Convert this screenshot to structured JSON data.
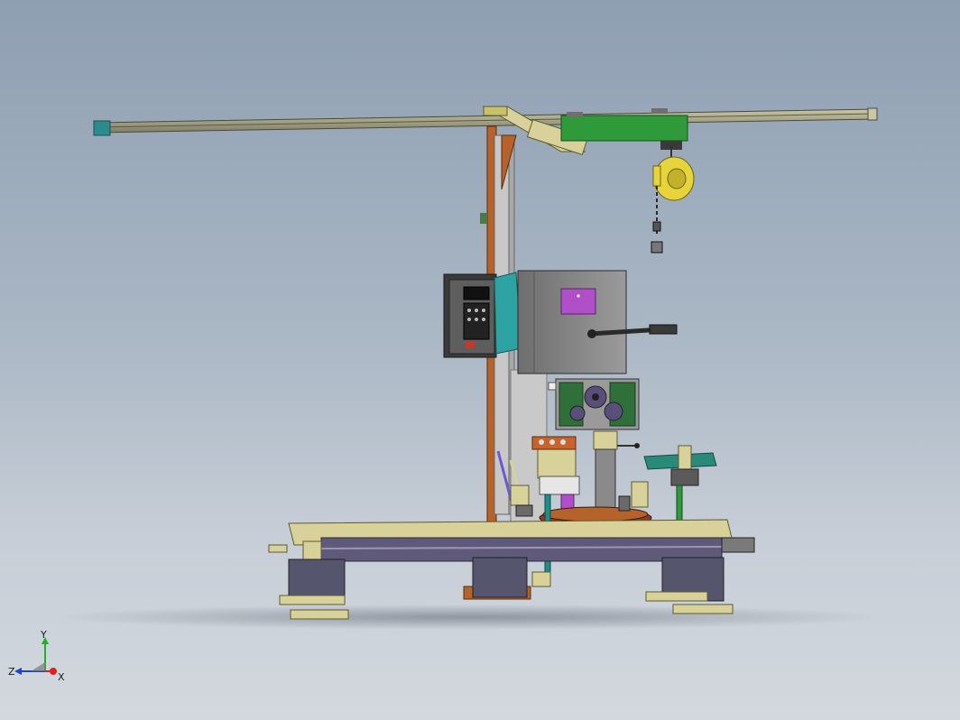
{
  "triad": {
    "x_label": "X",
    "y_label": "Y",
    "z_label": "Z"
  },
  "colors": {
    "background_top": "#8e9fb2",
    "background_bottom": "#d3d8de",
    "frame_beige": "#d8d29a",
    "column_rust": "#b5622b",
    "trolley_green": "#2f9a3a",
    "balancer_yellow": "#e7d43a",
    "cabinet_gray": "#8c8c8c",
    "panel_teal": "#2ea3a3",
    "pad_magenta": "#b050c8",
    "shaft_teal": "#1f8e8a",
    "axis_x": "#e02020",
    "axis_y": "#22b024",
    "axis_z": "#2040d0"
  }
}
